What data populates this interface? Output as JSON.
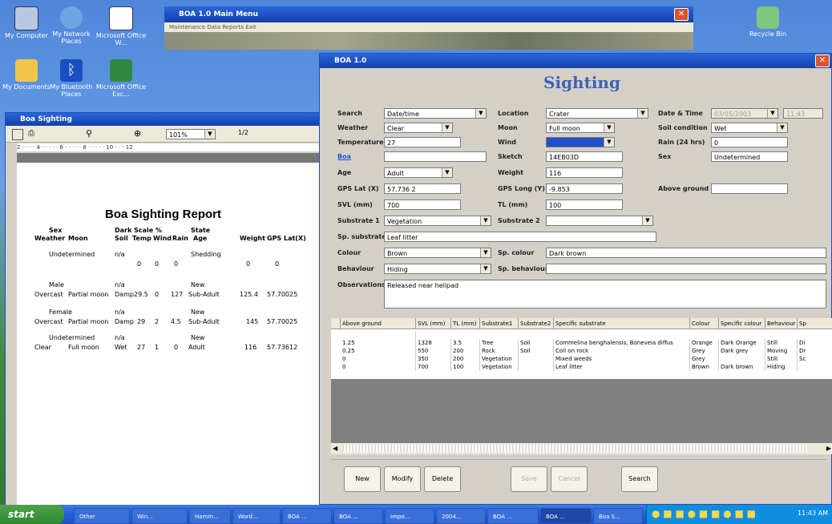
{
  "desktop": {
    "icons": [
      {
        "label": "My Computer"
      },
      {
        "label": "My Network Places"
      },
      {
        "label": "Microsoft Office W..."
      },
      {
        "label": "Recycle Bin"
      },
      {
        "label": "My Documents"
      },
      {
        "label": "My Bluetooth Places"
      },
      {
        "label": "Microsoft Office Exc..."
      }
    ]
  },
  "main_menu": {
    "title": "BOA 1.0 Main Menu",
    "menu": "Maintenance   Data   Reports   Exit"
  },
  "report_window": {
    "title": "Boa Sighting",
    "toolbar_zoom": "101%",
    "toolbar_rest": "1/2",
    "ruler": "2 · · · · 4 · · · · · 6 · · · · · 8 · · · · · 10 · · · 12",
    "report_title": "Boa Sighting Report",
    "header1": {
      "sex": "Sex",
      "dark": "Dark Scale %",
      "state": "State"
    },
    "header2": {
      "weather": "Weather",
      "moon": "Moon",
      "soil": "Soil",
      "temp": "Temp",
      "wind": "Wind",
      "rain": "Rain",
      "age": "Age",
      "weight": "Weight",
      "gps": "GPS Lat(X)"
    },
    "records": [
      {
        "sex": "Undetermined",
        "dark": "n/a",
        "state": "Shedding",
        "weather": "",
        "moon": "",
        "soil": "",
        "temp": "0",
        "wind": "0",
        "rain": "0",
        "age": "",
        "weight": "0",
        "gps": "0"
      },
      {
        "sex": "Male",
        "dark": "n/a",
        "state": "New",
        "weather": "Overcast",
        "moon": "Partial moon",
        "soil": "Damp",
        "temp": "29.5",
        "wind": "0",
        "rain": "127",
        "age": "Sub-Adult",
        "weight": "125.4",
        "gps": "57.70025"
      },
      {
        "sex": "Female",
        "dark": "n/a",
        "state": "New",
        "weather": "Overcast",
        "moon": "Partial moon",
        "soil": "Damp",
        "temp": "29",
        "wind": "2",
        "rain": "4.5",
        "age": "Sub-Adult",
        "weight": "145",
        "gps": "57.70025"
      },
      {
        "sex": "Undetermined",
        "dark": "n/a",
        "state": "New",
        "weather": "Clear",
        "moon": "Full moon",
        "soil": "Wet",
        "temp": "27",
        "wind": "1",
        "rain": "0",
        "age": "Adult",
        "weight": "116",
        "gps": "57.73612"
      }
    ]
  },
  "sighting": {
    "window_title": "BOA 1.0",
    "heading": "Sighting",
    "labels": {
      "search": "Search",
      "location": "Location",
      "datetime": "Date & Time",
      "weather": "Weather",
      "moon": "Moon",
      "soil": "Soil condition",
      "temperature": "Temperature",
      "wind": "Wind",
      "rain": "Rain (24 hrs)",
      "boa": "Boa",
      "sketch": "Sketch",
      "sex": "Sex",
      "age": "Age",
      "weight": "Weight",
      "gps_lat": "GPS Lat (X)",
      "gps_long": "GPS Long (Y)",
      "above_ground": "Above ground",
      "svl": "SVL (mm)",
      "tl": "TL (mm)",
      "substrate1": "Substrate 1",
      "substrate2": "Substrate 2",
      "sp_substrate": "Sp. substrate",
      "colour": "Colour",
      "sp_colour": "Sp. colour",
      "behaviour": "Behaviour",
      "sp_behaviour": "Sp. behaviour",
      "observations": "Observations"
    },
    "values": {
      "search": "Date/time",
      "location": "Crater",
      "date": "03/05/2003",
      "time": "11:43",
      "weather": "Clear",
      "moon": "Full moon",
      "soil": "Wet",
      "temperature": "27",
      "wind": "",
      "rain": "0",
      "boa": "",
      "sketch": "14EB03D",
      "sex": "Undetermined",
      "age": "Adult",
      "weight": "116",
      "gps_lat": "57.736 2",
      "gps_long": "-9.853",
      "above_ground": "",
      "svl": "700",
      "tl": "100",
      "substrate1": "Vegetation",
      "substrate2": "",
      "sp_substrate": "Leaf litter",
      "colour": "Brown",
      "sp_colour": "Dark brown",
      "behaviour": "Hiding",
      "sp_behaviour": "",
      "observations": "Released near helipad"
    },
    "grid": {
      "columns": [
        "Above ground",
        "SVL (mm)",
        "TL (mm)",
        "Substrate1",
        "Substrate2",
        "Specific substrate",
        "Colour",
        "Specific colour",
        "Behaviour",
        "Sp"
      ],
      "rows": [
        [
          "",
          "",
          "",
          "",
          "",
          "",
          "",
          "",
          "",
          ""
        ],
        [
          "1.25",
          "1328",
          "3.5",
          "Tree",
          "Soil",
          "Commelina benghalensis, Boneveia diffus",
          "Orange",
          "Dark Orange",
          "Still",
          "Di"
        ],
        [
          "0.25",
          "550",
          "200",
          "Rock",
          "Soil",
          "Coil on rock",
          "Grey",
          "Dark grey",
          "Moving",
          "Dr"
        ],
        [
          "0",
          "350",
          "200",
          "Vegetation",
          "",
          "Mixed weeds",
          "Grey",
          "",
          "Still",
          "Sc"
        ],
        [
          "0",
          "700",
          "100",
          "Vegetation",
          "",
          "Leaf litter",
          "Brown",
          "Dark brown",
          "Hiding",
          ""
        ]
      ]
    },
    "buttons": {
      "new": "New",
      "modify": "Modify",
      "delete": "Delete",
      "save": "Save",
      "cancel": "Cancel",
      "search": "Search"
    }
  },
  "taskbar": {
    "start": "start",
    "items": [
      "Other",
      "Win...",
      "Hamm...",
      "Word...",
      "BOA ...",
      "BOA ...",
      "Impo...",
      "2004...",
      "BOA ...",
      "BOA ...",
      "Boa S..."
    ],
    "clock": "11:43 AM"
  }
}
